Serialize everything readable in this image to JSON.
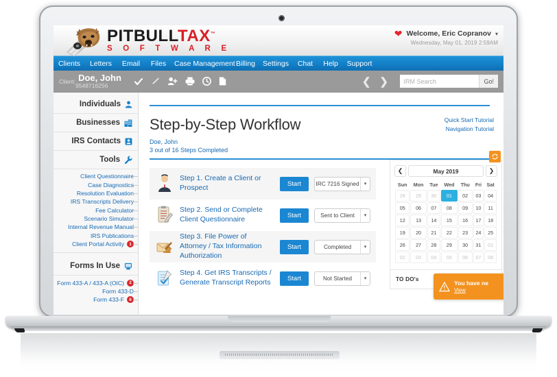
{
  "brand": {
    "logo_line1_a": "PITBULL",
    "logo_line1_b": "TAX",
    "logo_tm": "™",
    "logo_line2": "S O F T W A R E",
    "accent_blue": "#1583cb",
    "accent_red": "#d81f26",
    "accent_orange": "#f3921f"
  },
  "header": {
    "heart_icon": "heart-icon",
    "welcome": "Welcome, Eric Copranov",
    "caret": "▾",
    "datetime": "Wednesday, May 01, 2019 2:59AM"
  },
  "nav": {
    "items": [
      {
        "label": "Clients"
      },
      {
        "label": "Letters"
      },
      {
        "label": "Email"
      },
      {
        "label": "Files"
      },
      {
        "label": "Case Management"
      },
      {
        "label": "Billing"
      },
      {
        "label": "Settings"
      },
      {
        "label": "Chat"
      },
      {
        "label": "Help"
      },
      {
        "label": "Support"
      }
    ]
  },
  "clientbar": {
    "label": "Client:",
    "name": "Doe, John",
    "id": "9548716256",
    "icons": [
      "check-icon",
      "pencil-icon",
      "add-user-icon",
      "print-icon",
      "clock-icon",
      "document-icon"
    ],
    "prev_arrow": "❮",
    "next_arrow": "❯",
    "search_placeholder": "IRM Search",
    "search_value": "",
    "search_button": "Go!"
  },
  "sidebar": {
    "sections": [
      {
        "title": "Individuals",
        "icon": "person-icon"
      },
      {
        "title": "Businesses",
        "icon": "building-icon"
      },
      {
        "title": "IRS Contacts",
        "icon": "contact-card-icon"
      },
      {
        "title": "Tools",
        "icon": "wrench-icon"
      }
    ],
    "tools": [
      {
        "label": "Client Questionnaire",
        "badge": ""
      },
      {
        "label": "Case Diagnostics",
        "badge": ""
      },
      {
        "label": "Resolution Evaluation",
        "badge": ""
      },
      {
        "label": "IRS Transcripts Delivery",
        "badge": ""
      },
      {
        "label": "Fee Calculator",
        "badge": ""
      },
      {
        "label": "Scenario Simulator",
        "badge": ""
      },
      {
        "label": "Internal Revenue Manual",
        "badge": ""
      },
      {
        "label": "IRS Publications",
        "badge": ""
      },
      {
        "label": "Client Portal Activity",
        "badge": "1"
      }
    ],
    "forms_title": "Forms In Use",
    "forms_icon": "printer-forms-icon",
    "forms": [
      {
        "label": "Form 433-A / 433-A (OIC)",
        "badge": "2"
      },
      {
        "label": "Form 433-D",
        "badge": ""
      },
      {
        "label": "Form 433-F",
        "badge": "6"
      }
    ]
  },
  "main": {
    "page_title": "Step-by-Step Workflow",
    "client_name": "Doe, John",
    "progress_text": "3 out of 16 Steps Completed",
    "tutorial_links": [
      {
        "label": "Quick Start Tutorial"
      },
      {
        "label": "Navigation Tutorial"
      }
    ],
    "start_label": "Start",
    "dropdown_arrow": "▾",
    "steps": [
      {
        "icon": "businessman-icon",
        "title": "Step 1. Create a Client or Prospect",
        "button": "Start",
        "status": "IRC 7216 Signed"
      },
      {
        "icon": "clipboard-icon",
        "title": "Step 2. Send or Complete Client Questionnaire",
        "button": "Start",
        "status": "Sent to Client"
      },
      {
        "icon": "gavel-envelope-icon",
        "title": "Step 3. File Power of Attorney / Tax Information Authorization",
        "button": "Start",
        "status": "Completed"
      },
      {
        "icon": "transcript-icon",
        "title": "Step 4. Get IRS Transcripts / Generate Transcript Reports",
        "button": "Start",
        "status": "Not Started"
      }
    ]
  },
  "calendar": {
    "refresh_icon": "refresh-icon",
    "prev": "❮",
    "next": "❯",
    "month_label": "May 2019",
    "weekdays": [
      "Sun",
      "Mon",
      "Tue",
      "Wed",
      "Thu",
      "Fri",
      "Sat"
    ],
    "weeks": [
      [
        {
          "d": "28",
          "m": true
        },
        {
          "d": "29",
          "m": true
        },
        {
          "d": "30",
          "m": true
        },
        {
          "d": "01",
          "today": true
        },
        {
          "d": "02"
        },
        {
          "d": "03"
        },
        {
          "d": "04"
        }
      ],
      [
        {
          "d": "05"
        },
        {
          "d": "06"
        },
        {
          "d": "07"
        },
        {
          "d": "08"
        },
        {
          "d": "09"
        },
        {
          "d": "10"
        },
        {
          "d": "11"
        }
      ],
      [
        {
          "d": "12"
        },
        {
          "d": "13"
        },
        {
          "d": "14"
        },
        {
          "d": "15"
        },
        {
          "d": "16"
        },
        {
          "d": "17"
        },
        {
          "d": "18"
        }
      ],
      [
        {
          "d": "19"
        },
        {
          "d": "20"
        },
        {
          "d": "21"
        },
        {
          "d": "22"
        },
        {
          "d": "23"
        },
        {
          "d": "24"
        },
        {
          "d": "25"
        }
      ],
      [
        {
          "d": "26"
        },
        {
          "d": "27"
        },
        {
          "d": "28"
        },
        {
          "d": "29"
        },
        {
          "d": "30"
        },
        {
          "d": "31"
        },
        {
          "d": "01",
          "m": true
        }
      ],
      [
        {
          "d": "02",
          "m": true
        },
        {
          "d": "03",
          "m": true
        },
        {
          "d": "04",
          "m": true
        },
        {
          "d": "05",
          "m": true
        },
        {
          "d": "06",
          "m": true
        },
        {
          "d": "07",
          "m": true
        },
        {
          "d": "08",
          "m": true
        }
      ]
    ]
  },
  "todo": {
    "title": "TO DO's"
  },
  "toast": {
    "icon": "warning-icon",
    "message": "You have ne",
    "link": "View"
  }
}
